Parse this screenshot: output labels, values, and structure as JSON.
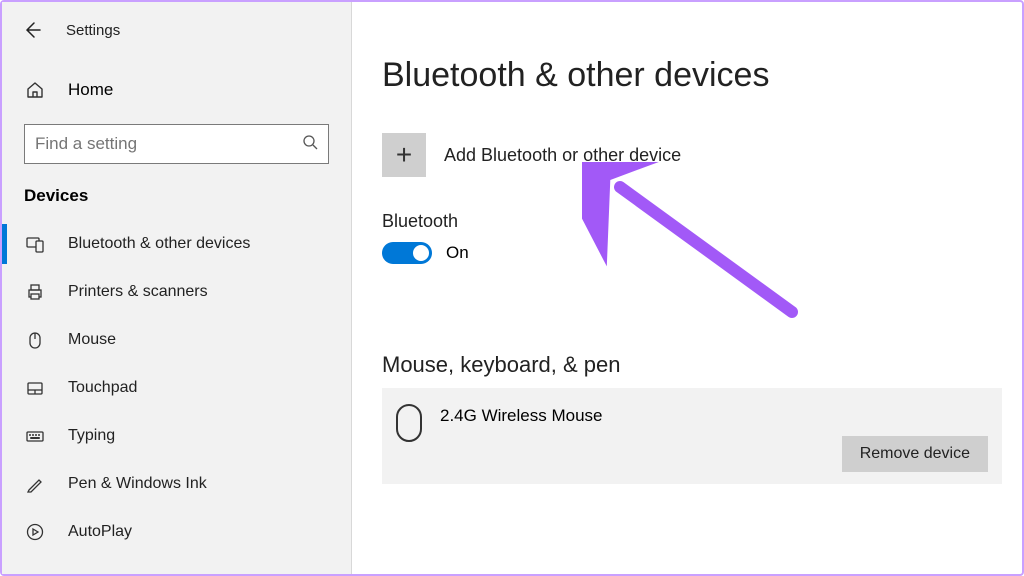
{
  "header": {
    "app_title": "Settings"
  },
  "home_label": "Home",
  "search": {
    "placeholder": "Find a setting"
  },
  "sidebar": {
    "section_title": "Devices",
    "items": [
      {
        "icon": "devices",
        "label": "Bluetooth & other devices",
        "active": true
      },
      {
        "icon": "printer",
        "label": "Printers & scanners"
      },
      {
        "icon": "mouse",
        "label": "Mouse"
      },
      {
        "icon": "touchpad",
        "label": "Touchpad"
      },
      {
        "icon": "typing",
        "label": "Typing"
      },
      {
        "icon": "pen",
        "label": "Pen & Windows Ink"
      },
      {
        "icon": "autoplay",
        "label": "AutoPlay"
      }
    ]
  },
  "page": {
    "title": "Bluetooth & other devices",
    "add_device_label": "Add Bluetooth or other device",
    "bt_section_title": "Bluetooth",
    "bt_toggle_state": "On",
    "device_section_title": "Mouse, keyboard, & pen",
    "device_name": "2.4G Wireless Mouse",
    "remove_button_label": "Remove device"
  },
  "colors": {
    "accent": "#0078d7",
    "arrow": "#a259f7"
  }
}
